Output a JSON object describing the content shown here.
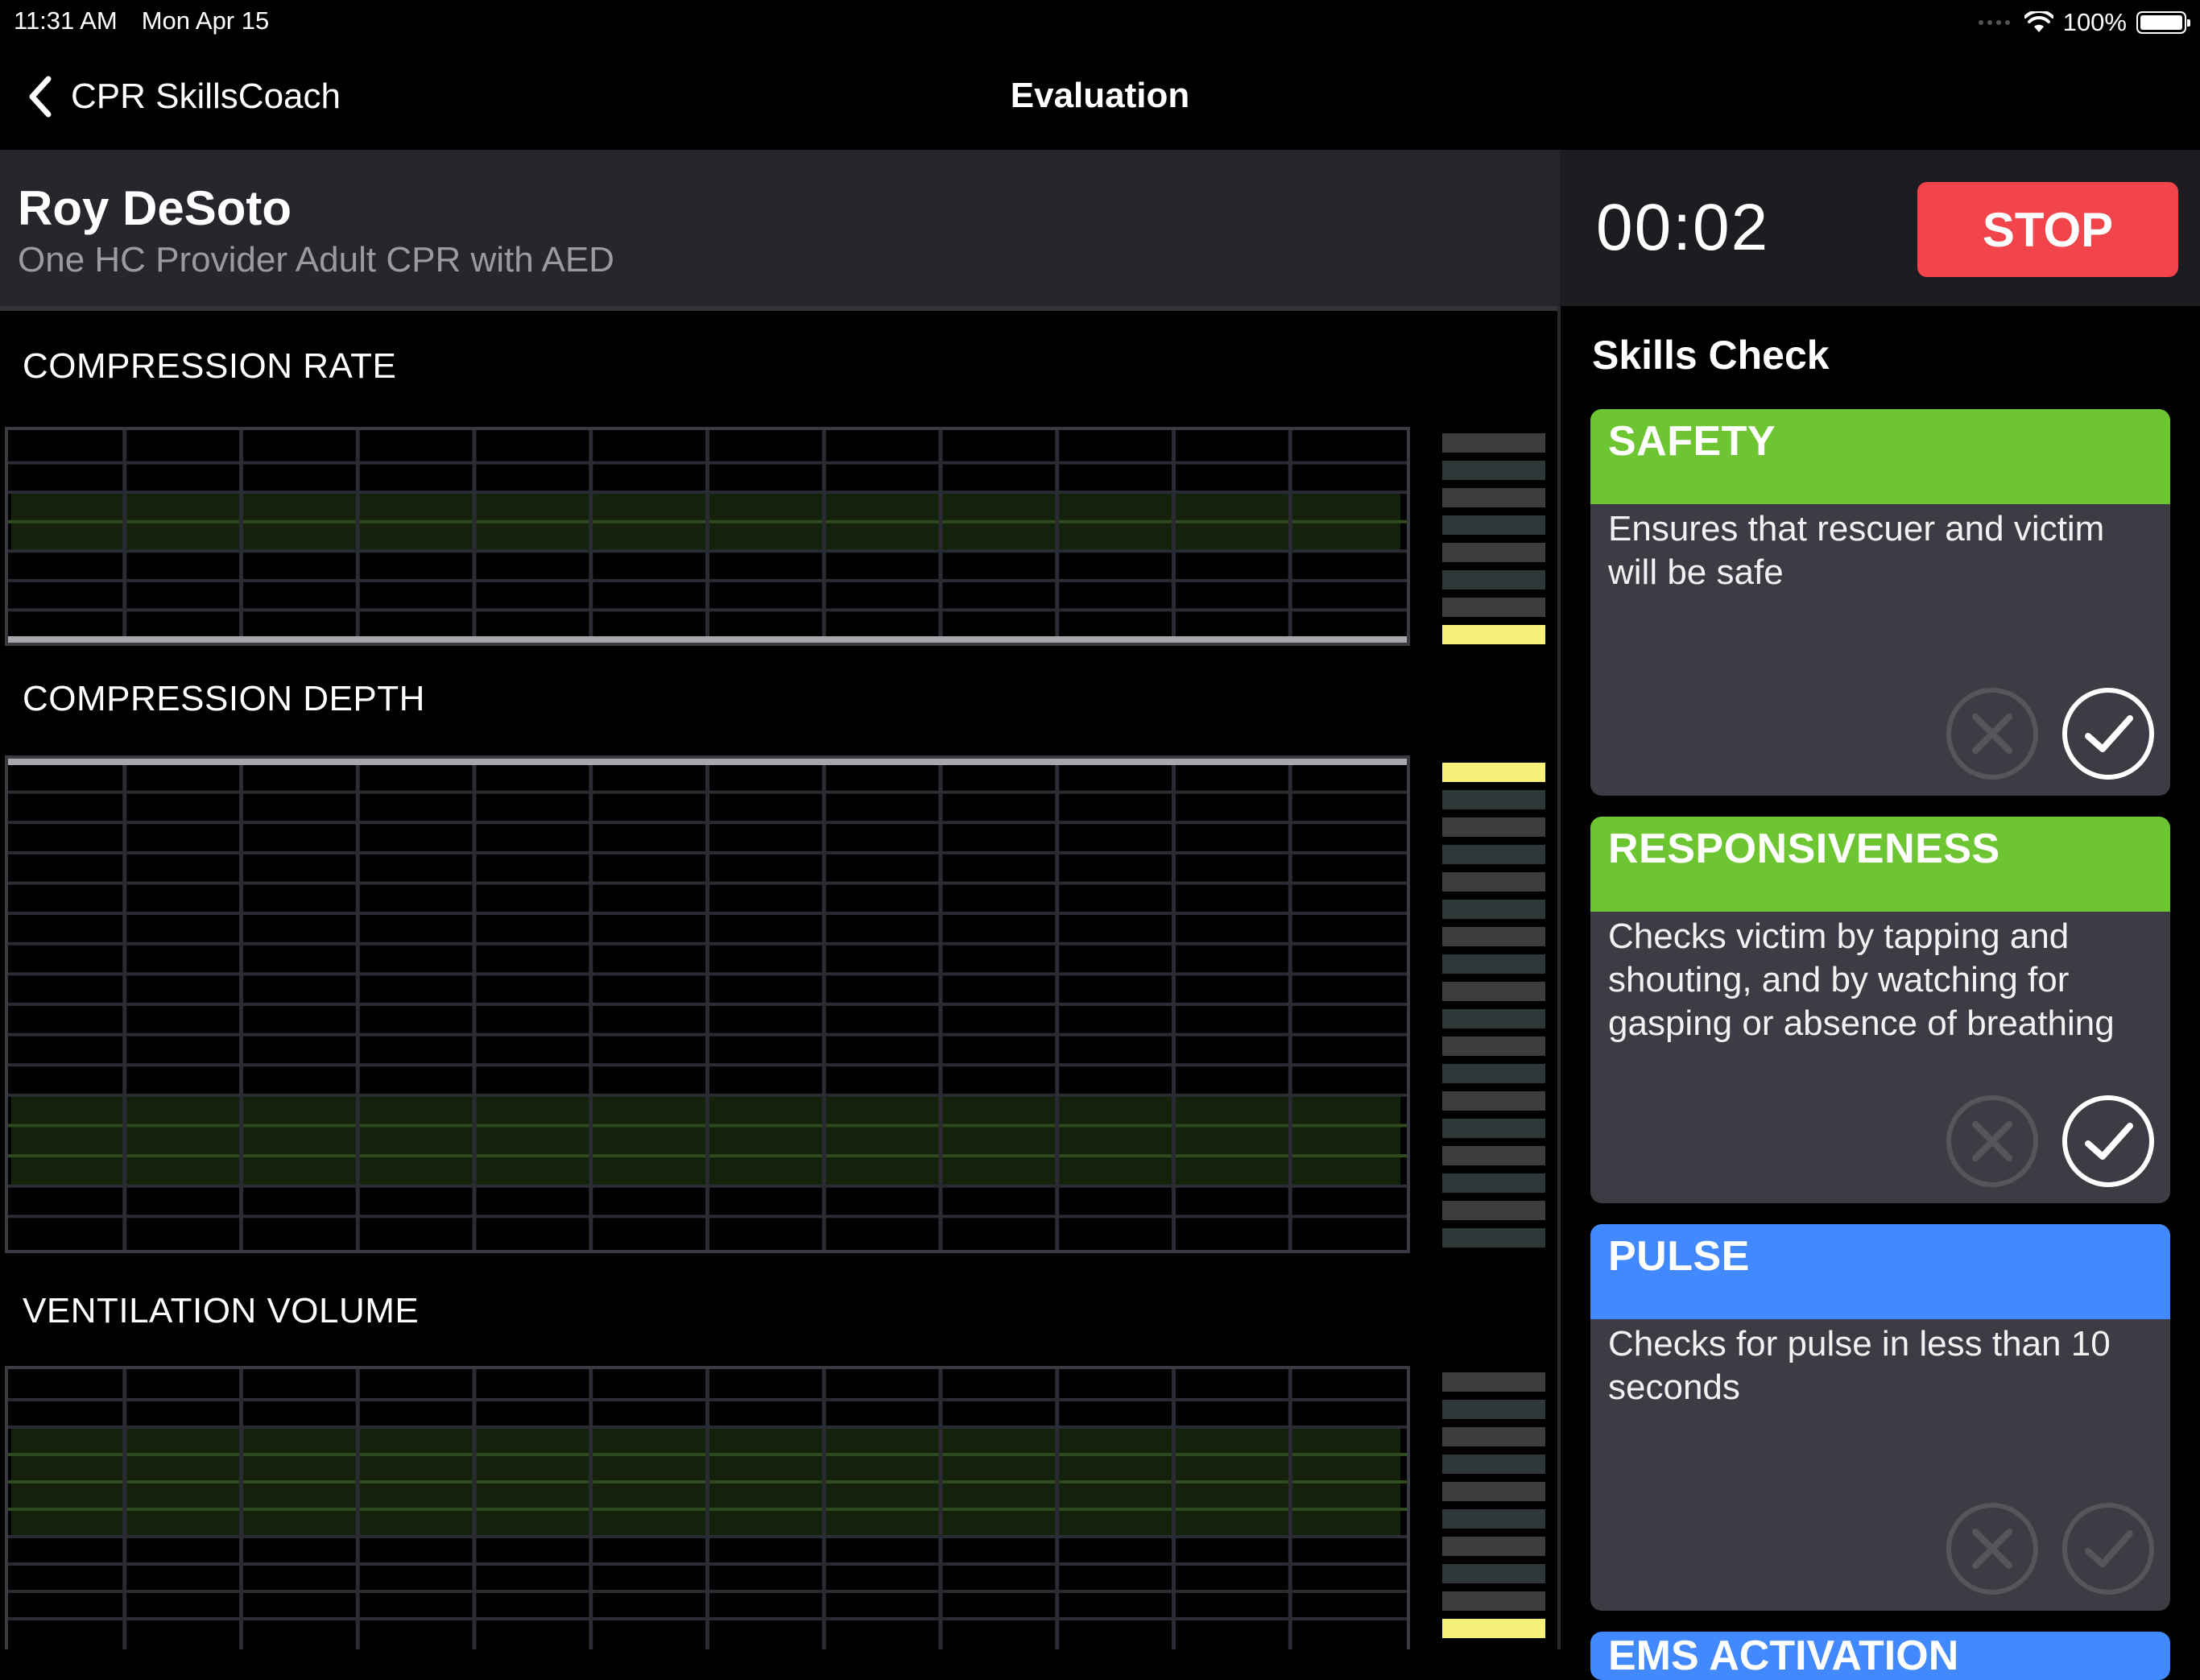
{
  "status_bar": {
    "time": "11:31 AM",
    "date": "Mon Apr 15",
    "battery": "100%"
  },
  "nav": {
    "back_label": "CPR SkillsCoach",
    "title": "Evaluation"
  },
  "trainee": {
    "name": "Roy DeSoto",
    "course": "One HC Provider Adult CPR with AED"
  },
  "timer": {
    "value": "00:02",
    "stop_label": "STOP"
  },
  "charts": [
    {
      "title": "COMPRESSION RATE",
      "meter_level_fraction": 0.125
    },
    {
      "title": "COMPRESSION DEPTH",
      "meter_level_fraction": 0.05
    },
    {
      "title": "VENTILATION VOLUME",
      "meter_level_fraction": 0.1
    }
  ],
  "skills": {
    "title": "Skills Check",
    "items": [
      {
        "name": "SAFETY",
        "description": "Ensures that rescuer and victim will be safe",
        "color": "#6cc531",
        "passed": true
      },
      {
        "name": "RESPONSIVENESS",
        "description": "Checks victim by tapping and shouting, and by watching for gasping or absence of breathing",
        "color": "#6cc531",
        "passed": true
      },
      {
        "name": "PULSE",
        "description": "Checks for pulse in less than 10 seconds",
        "color": "#4288ff",
        "passed": false
      }
    ],
    "next_partial": {
      "name": "EMS ACTIVATION",
      "color": "#4288ff"
    }
  },
  "icons": [
    "back-chevron-icon",
    "wifi-icon",
    "battery-icon",
    "x-icon",
    "checkmark-icon"
  ]
}
